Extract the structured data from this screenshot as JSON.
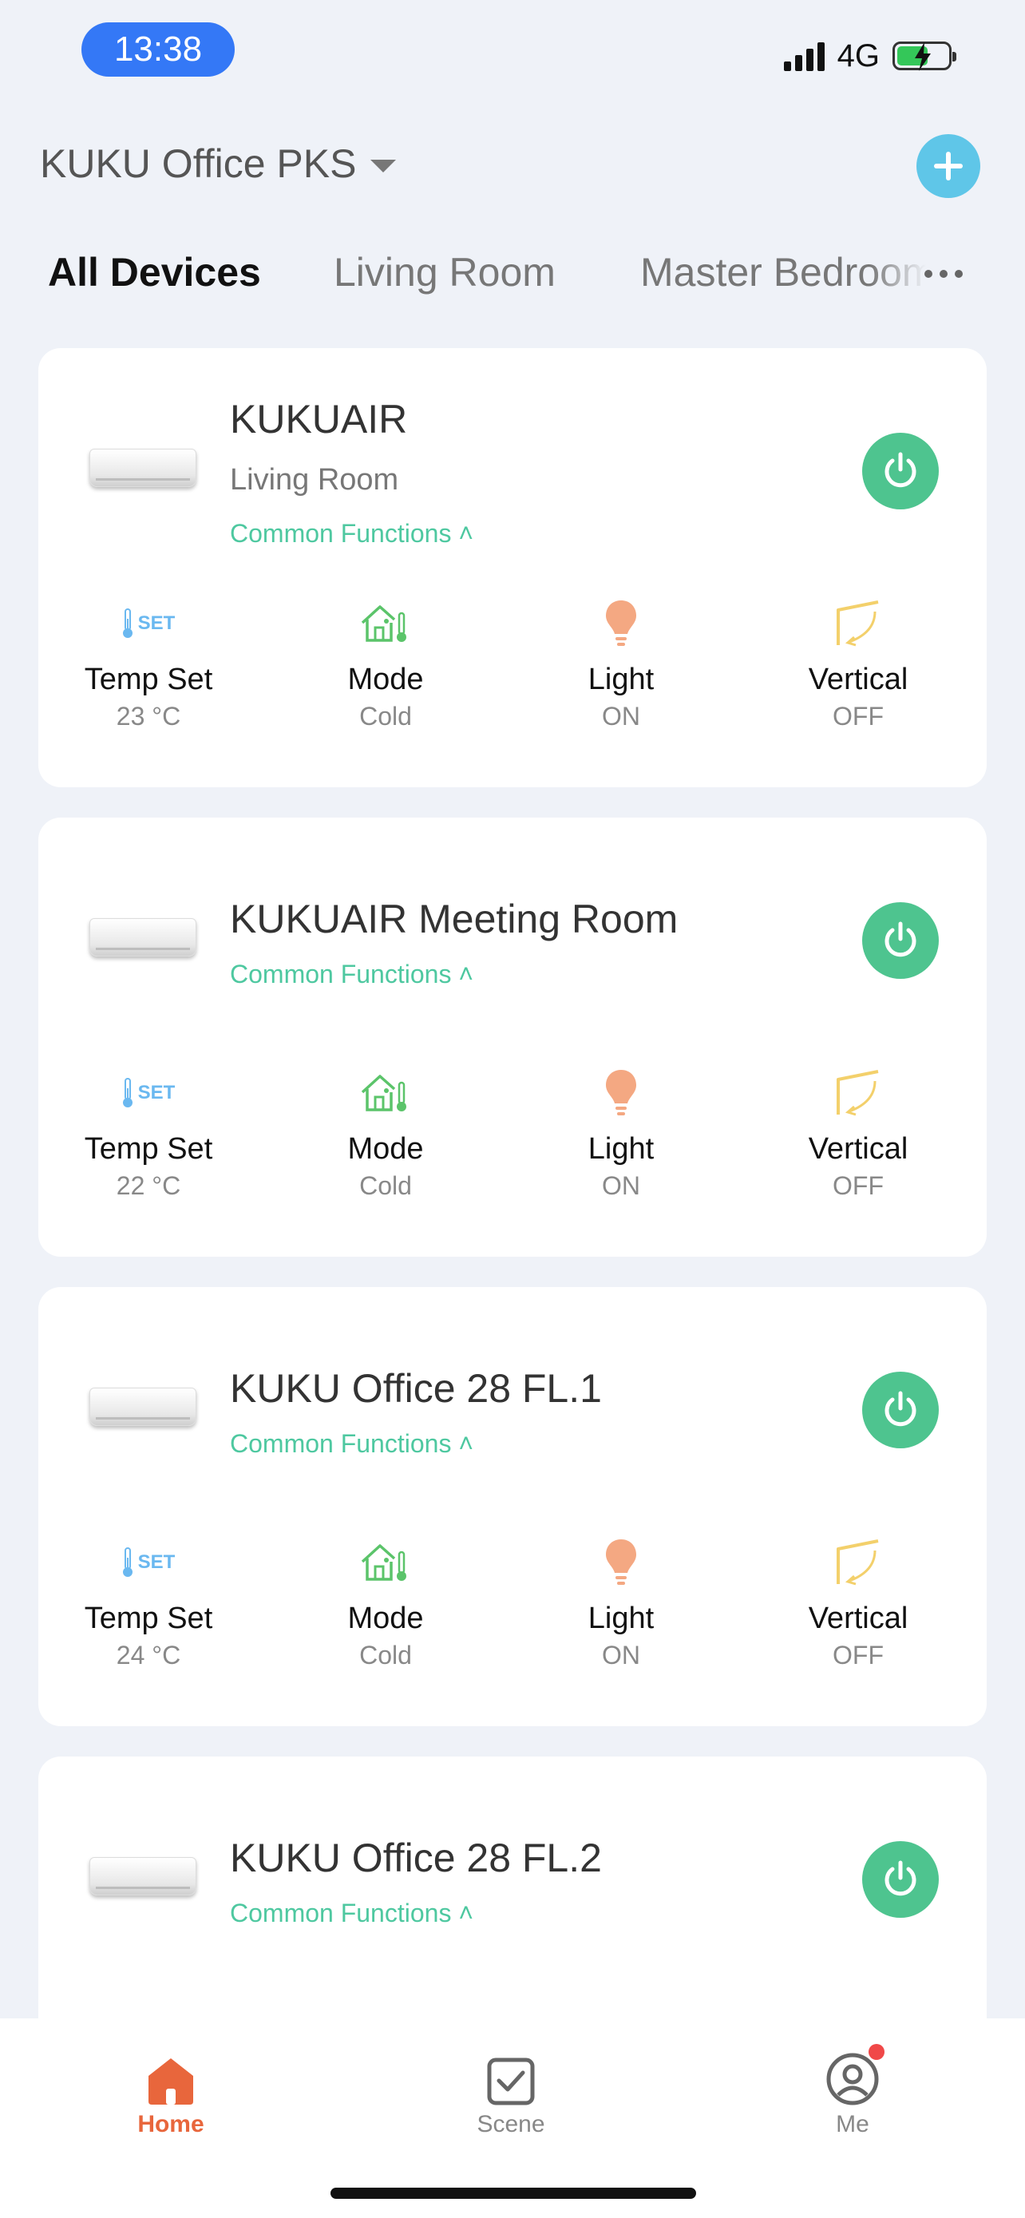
{
  "status_bar": {
    "time": "13:38",
    "network": "4G"
  },
  "header": {
    "home_name": "KUKU Office PKS"
  },
  "tabs": [
    "All Devices",
    "Living Room",
    "Master Bedroom"
  ],
  "devices": [
    {
      "name": "KUKUAIR",
      "room": "Living Room",
      "common_functions": "Common Functions ˄",
      "functions": {
        "temp_label": "Temp Set",
        "temp_value": "23 °C",
        "mode_label": "Mode",
        "mode_value": "Cold",
        "light_label": "Light",
        "light_value": "ON",
        "vertical_label": "Vertical",
        "vertical_value": "OFF"
      }
    },
    {
      "name": "KUKUAIR Meeting Room",
      "room": "",
      "common_functions": "Common Functions ˄",
      "functions": {
        "temp_label": "Temp Set",
        "temp_value": "22 °C",
        "mode_label": "Mode",
        "mode_value": "Cold",
        "light_label": "Light",
        "light_value": "ON",
        "vertical_label": "Vertical",
        "vertical_value": "OFF"
      }
    },
    {
      "name": "KUKU Office 28 FL.1",
      "room": "",
      "common_functions": "Common Functions ˄",
      "functions": {
        "temp_label": "Temp Set",
        "temp_value": "24 °C",
        "mode_label": "Mode",
        "mode_value": "Cold",
        "light_label": "Light",
        "light_value": "ON",
        "vertical_label": "Vertical",
        "vertical_value": "OFF"
      }
    },
    {
      "name": "KUKU Office 28 FL.2",
      "room": "",
      "common_functions": "Common Functions ˄"
    }
  ],
  "icons": {
    "set_text": "SET"
  },
  "tab_bar": {
    "home": "Home",
    "scene": "Scene",
    "me": "Me"
  },
  "colors": {
    "accent_green": "#4ec48f",
    "accent_orange": "#e8663c",
    "add_button": "#5fc6e8",
    "time_pill": "#3478f6"
  }
}
